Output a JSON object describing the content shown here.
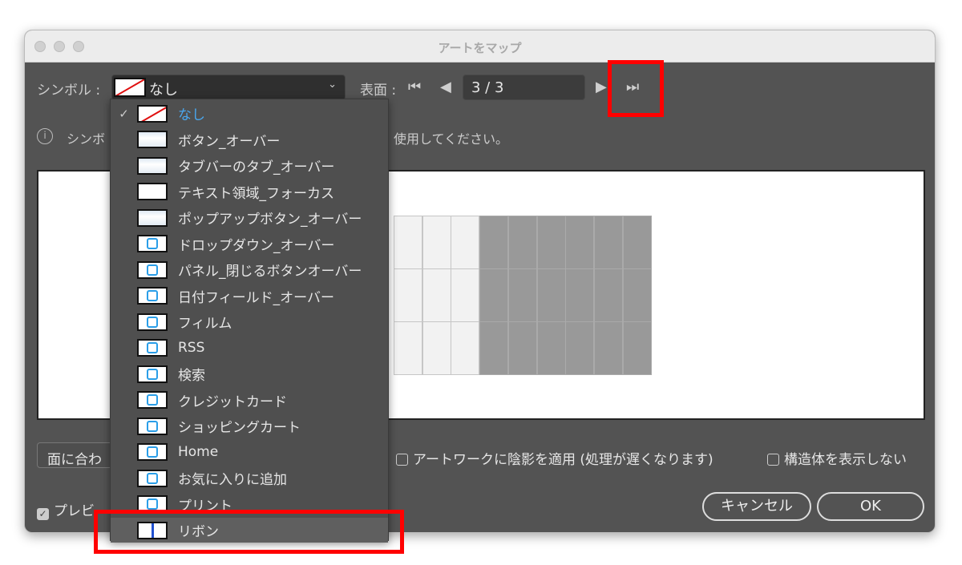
{
  "window": {
    "title": "アートをマップ"
  },
  "symbol": {
    "label": "シンボル :",
    "selected": "なし"
  },
  "surface": {
    "label": "表面 :",
    "page": "3 / 3"
  },
  "info": {
    "text_left": "シンボ",
    "text_right": "使用してください。"
  },
  "dropdown": {
    "items": [
      {
        "label": "なし",
        "icon": "none-icon",
        "checked": true
      },
      {
        "label": "ボタン_オーバー",
        "icon": "button-icon"
      },
      {
        "label": "タブバーのタブ_オーバー",
        "icon": "tab-icon"
      },
      {
        "label": "テキスト領域_フォーカス",
        "icon": "text-area-icon"
      },
      {
        "label": "ポップアップボタン_オーバー",
        "icon": "popup-icon"
      },
      {
        "label": "ドロップダウン_オーバー",
        "icon": "dropdown-icon"
      },
      {
        "label": "パネル_閉じるボタンオーバー",
        "icon": "close-icon"
      },
      {
        "label": "日付フィールド_オーバー",
        "icon": "calendar-icon"
      },
      {
        "label": "フィルム",
        "icon": "film-icon"
      },
      {
        "label": "RSS",
        "icon": "rss-icon"
      },
      {
        "label": "検索",
        "icon": "search-icon"
      },
      {
        "label": "クレジットカード",
        "icon": "credit-card-icon"
      },
      {
        "label": "ショッピングカート",
        "icon": "cart-icon"
      },
      {
        "label": "Home",
        "icon": "home-icon"
      },
      {
        "label": "お気に入りに追加",
        "icon": "favorite-icon"
      },
      {
        "label": "プリント",
        "icon": "print-icon"
      },
      {
        "label": "リボン",
        "icon": "ribbon-icon",
        "highlighted": true
      }
    ]
  },
  "options": {
    "fit_button": "面に合わ",
    "shade_label": "アートワークに陰影を適用 (処理が遅くなります)",
    "hide_geometry_label": "構造体を表示しない",
    "preview_label": "プレビ"
  },
  "buttons": {
    "cancel": "キャンセル",
    "ok": "OK"
  },
  "colors": {
    "accent": "#4aa8f0",
    "highlight_box": "#ff0000"
  }
}
